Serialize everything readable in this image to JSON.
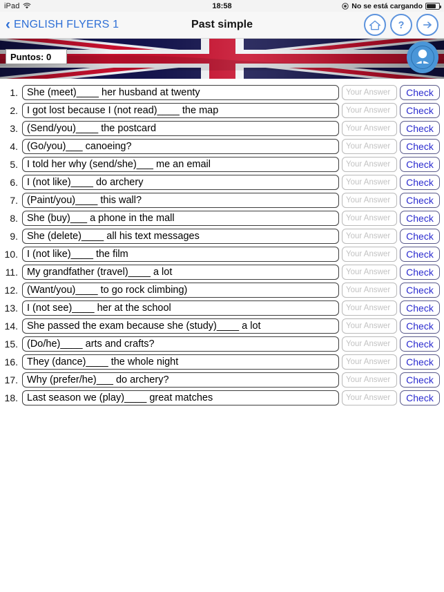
{
  "status_bar": {
    "device": "iPad",
    "wifi_icon": "wifi-icon",
    "time": "18:58",
    "location_icon": "location-icon",
    "charging_text": "No se está cargando",
    "battery_icon": "battery-icon"
  },
  "nav_bar": {
    "back_icon": "chevron-left-icon",
    "back_label": "ENGLISH FLYERS 1",
    "title": "Past simple",
    "actions": [
      {
        "name": "home-button",
        "icon": "home-icon"
      },
      {
        "name": "help-button",
        "icon": "question-mark-icon"
      },
      {
        "name": "next-button",
        "icon": "arrow-right-icon"
      }
    ],
    "accent_color": "#2e6fd6",
    "button_border_color": "#5c93dd"
  },
  "banner": {
    "flag_icon": "union-jack-flag",
    "score_label": "Puntos: 0",
    "avatar_icon": "user-avatar-icon",
    "avatar_color": "#4a96d8"
  },
  "exercise": {
    "answer_placeholder": "Your Answer",
    "check_label": "Check",
    "check_color": "#2b2bcf",
    "items": [
      {
        "num": "1.",
        "sentence": "She (meet)____ her husband at twenty"
      },
      {
        "num": "2.",
        "sentence": "I got lost because I (not read)____ the map"
      },
      {
        "num": "3.",
        "sentence": "(Send/you)____ the postcard"
      },
      {
        "num": "4.",
        "sentence": "(Go/you)___ canoeing?"
      },
      {
        "num": "5.",
        "sentence": "I told her why (send/she)___ me an email"
      },
      {
        "num": "6.",
        "sentence": "I (not like)____ do archery"
      },
      {
        "num": "7.",
        "sentence": "(Paint/you)____ this wall?"
      },
      {
        "num": "8.",
        "sentence": "She (buy)___ a phone in the mall"
      },
      {
        "num": "9.",
        "sentence": "She (delete)____ all his text messages"
      },
      {
        "num": "10.",
        "sentence": "I (not like)____ the film"
      },
      {
        "num": "11.",
        "sentence": "My grandfather (travel)____ a lot"
      },
      {
        "num": "12.",
        "sentence": "(Want/you)____ to go rock climbing)"
      },
      {
        "num": "13.",
        "sentence": "I (not see)____ her at the school"
      },
      {
        "num": "14.",
        "sentence": "She passed the exam because she (study)____ a lot"
      },
      {
        "num": "15.",
        "sentence": "(Do/he)____ arts and crafts?"
      },
      {
        "num": "16.",
        "sentence": "They (dance)____ the whole night"
      },
      {
        "num": "17.",
        "sentence": "Why (prefer/he)___ do archery?"
      },
      {
        "num": "18.",
        "sentence": "Last season we (play)____ great matches"
      }
    ]
  }
}
